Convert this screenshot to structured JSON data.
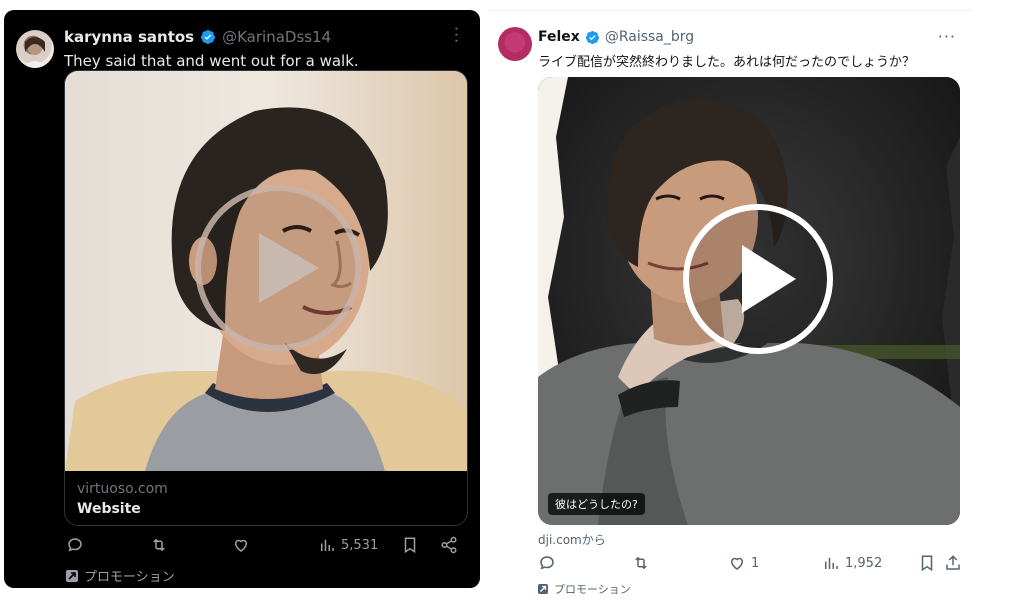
{
  "left_tweet": {
    "author_name": "karynna santos",
    "author_handle": "@KarinaDss14",
    "text": "They said that and went out for a walk.",
    "card": {
      "domain": "virtuoso.com",
      "title": "Website"
    },
    "actions": {
      "views_count": "5,531"
    },
    "promo_label": "プロモーション",
    "icons": [
      "reply-icon",
      "retweet-icon",
      "like-icon",
      "views-icon",
      "bookmark-icon",
      "share-icon",
      "play-icon",
      "verified-icon",
      "more-icon",
      "promo-icon"
    ]
  },
  "right_tweet": {
    "author_name": "Felex",
    "author_handle": "@Raissa_brg",
    "text": "ライブ配信が突然終わりました。あれは何だったのでしょうか？",
    "video_caption": "彼はどうしたの?",
    "source": "dji.comから",
    "actions": {
      "likes_count": "1",
      "views_count": "1,952"
    },
    "promo_label": "プロモーション",
    "icons": [
      "reply-icon",
      "retweet-icon",
      "like-icon",
      "views-icon",
      "bookmark-icon",
      "share-icon",
      "play-icon",
      "verified-icon",
      "more-icon",
      "promo-icon"
    ]
  },
  "colors": {
    "verified_blue": "#1d9bf0",
    "dark_bg": "#000000",
    "dark_text": "#e7e9ea",
    "dark_secondary": "#71767b",
    "light_text": "#0f1419",
    "light_secondary": "#536471"
  }
}
